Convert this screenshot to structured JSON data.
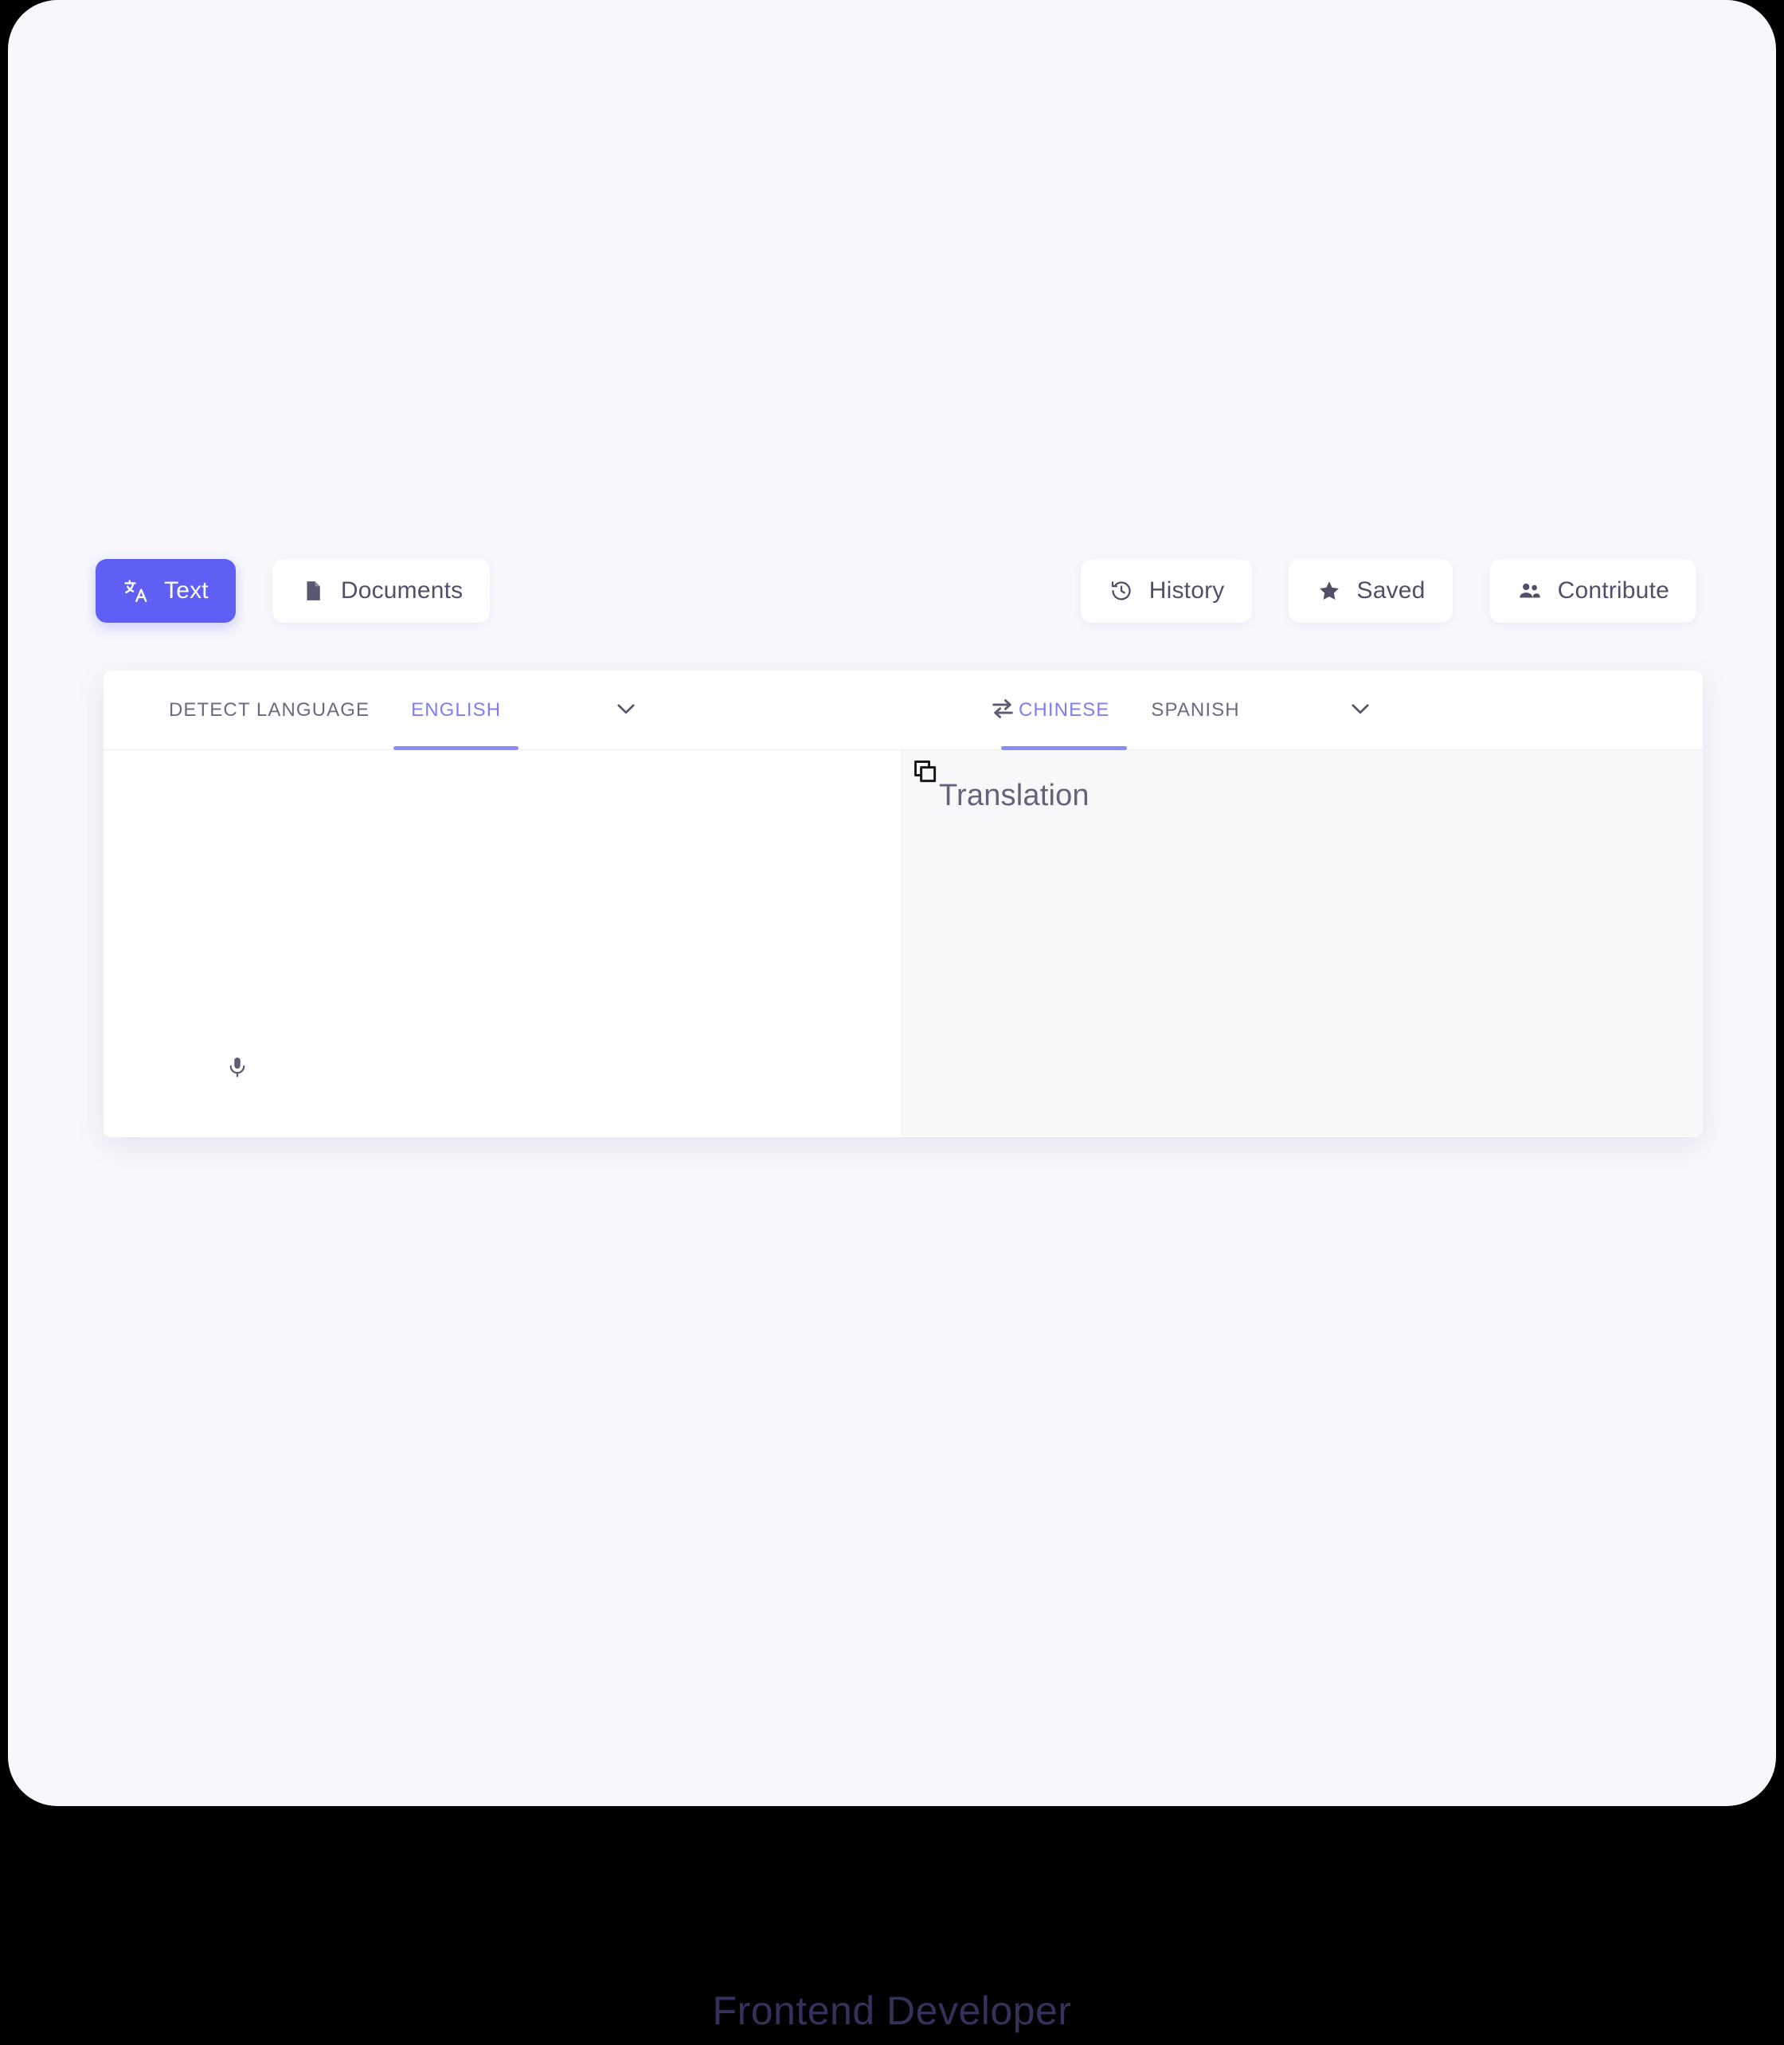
{
  "toolbar": {
    "left_tabs": [
      {
        "label": "Text",
        "icon": "translate-icon",
        "active": true
      },
      {
        "label": "Documents",
        "icon": "document-icon",
        "active": false
      }
    ],
    "right_actions": [
      {
        "label": "History",
        "icon": "history-icon"
      },
      {
        "label": "Saved",
        "icon": "star-icon"
      },
      {
        "label": "Contribute",
        "icon": "people-icon"
      }
    ]
  },
  "language_bar": {
    "source_options": [
      {
        "label": "Detect language",
        "selected": false
      },
      {
        "label": "English",
        "selected": true
      }
    ],
    "source_more_icon": "chevron-down-icon",
    "swap_icon": "swap-horizontal-icon",
    "target_options": [
      {
        "label": "Chinese",
        "selected": true
      },
      {
        "label": "Spanish",
        "selected": false
      }
    ],
    "target_more_icon": "chevron-down-icon"
  },
  "source_pane": {
    "value": "",
    "placeholder": "",
    "mic_icon": "microphone-icon"
  },
  "target_pane": {
    "copy_icon": "copy-icon",
    "translation_label": "Translation"
  },
  "footer": {
    "caption": "Frontend Developer"
  },
  "colors": {
    "accent": "#5f5ef5",
    "accent_light": "#8b8bfb",
    "surface": "#f7f7fc",
    "card": "#ffffff",
    "target_pane": "#f8f8fa",
    "text_muted": "#6b6b80",
    "page_background": "#000000",
    "caption": "#32325b"
  }
}
